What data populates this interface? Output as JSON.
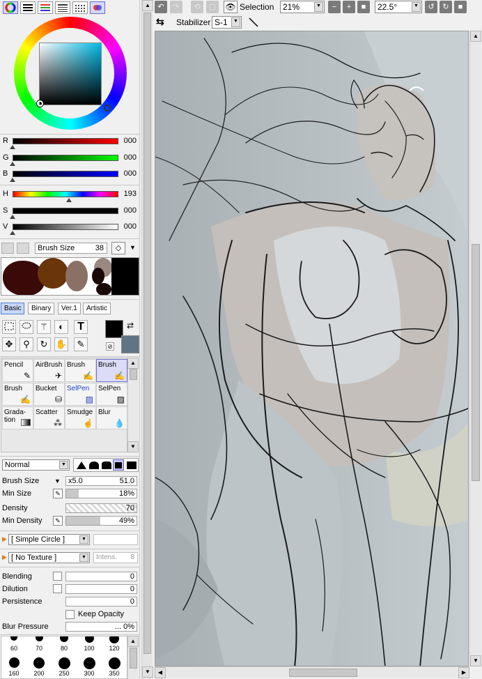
{
  "palette_tabs": [
    "color-wheel-icon",
    "rgb-sliders-icon",
    "hsv-sliders-icon",
    "swatches-icon",
    "swatch-grid-icon",
    "scratchpad-icon"
  ],
  "color_sliders": [
    {
      "label": "R",
      "value": "000",
      "fraction": 0.0
    },
    {
      "label": "G",
      "value": "000",
      "fraction": 0.0
    },
    {
      "label": "B",
      "value": "000",
      "fraction": 0.0
    },
    {
      "label": "H",
      "value": "193",
      "fraction": 0.536
    },
    {
      "label": "S",
      "value": "000",
      "fraction": 0.0
    },
    {
      "label": "V",
      "value": "000",
      "fraction": 0.0
    }
  ],
  "brush_size_bar": {
    "label": "Brush Size",
    "value": "38"
  },
  "brush_tabs": [
    "Basic",
    "Binary",
    "Ver.1",
    "Artistic"
  ],
  "brush_tools": [
    {
      "name": "Pencil",
      "icon": "pencil-icon"
    },
    {
      "name": "AirBrush",
      "icon": "airbrush-icon"
    },
    {
      "name": "Brush",
      "icon": "brush-icon"
    },
    {
      "name": "Brush",
      "icon": "brush-icon"
    },
    {
      "name": "Brush",
      "icon": "brush-icon"
    },
    {
      "name": "Bucket",
      "icon": "bucket-icon"
    },
    {
      "name": "SelPen",
      "icon": "selpen-icon"
    },
    {
      "name": "SelPen",
      "icon": "selpen-icon"
    },
    {
      "name": "Grada-\ntion",
      "icon": "gradation-icon"
    },
    {
      "name": "Scatter",
      "icon": "scatter-icon"
    },
    {
      "name": "Smudge",
      "icon": "smudge-icon"
    },
    {
      "name": "Blur",
      "icon": "blur-icon"
    }
  ],
  "selected_brush_index": 3,
  "blend_mode": "Normal",
  "brush_settings": {
    "brush_size_label": "Brush Size",
    "brush_size_multiplier": "x5.0",
    "brush_size_value": "51.0",
    "min_size_label": "Min Size",
    "min_size_value": "18%",
    "min_size_fraction": 0.18,
    "density_label": "Density",
    "density_value": "70",
    "density_fraction": 0.7,
    "min_density_label": "Min Density",
    "min_density_value": "49%",
    "min_density_fraction": 0.49
  },
  "shape_select": "[ Simple Circle ]",
  "texture_select": "[ No Texture ]",
  "texture_intensity_label": "Intens.",
  "texture_intensity_value": "8",
  "mixing": {
    "blending_label": "Blending",
    "blending_value": "0",
    "dilution_label": "Dilution",
    "dilution_value": "0",
    "persistence_label": "Persistence",
    "persistence_value": "0",
    "keep_opacity_label": "Keep Opacity",
    "blur_pressure_label": "Blur Pressure",
    "blur_pressure_value": "... 0%"
  },
  "brush_presets_row1": [
    "60",
    "70",
    "80",
    "100",
    "120"
  ],
  "brush_presets_row2": [
    "160",
    "200",
    "250",
    "300",
    "350"
  ],
  "toolbar": {
    "selection_label": "Selection",
    "zoom_value": "21%",
    "rotation_value": "22.5°",
    "stabilizer_label": "Stabilizer",
    "stabilizer_value": "S-1"
  },
  "colors": {
    "primary": "#000000",
    "secondary": "#5f7586",
    "hue_square_hue": "#00b9e6",
    "canvas_bg": "#b4bcc0"
  }
}
